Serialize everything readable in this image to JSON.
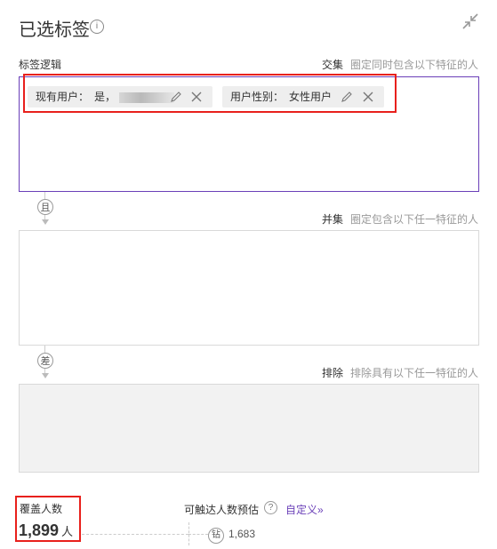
{
  "header": {
    "title": "已选标签",
    "info_icon": "i"
  },
  "logic": {
    "label": "标签逻辑"
  },
  "intersect": {
    "label": "交集",
    "description": "圈定同时包含以下特征的人",
    "tags": [
      {
        "name": "现有用户：",
        "value": "是，"
      },
      {
        "name": "用户性别：",
        "value": "女性用户"
      }
    ]
  },
  "op_and": "且",
  "union": {
    "label": "并集",
    "description": "圈定包含以下任一特征的人"
  },
  "op_diff": "差",
  "exclude": {
    "label": "排除",
    "description": "排除具有以下任一特征的人"
  },
  "coverage": {
    "label": "覆盖人数",
    "value": "1,899",
    "unit": "人"
  },
  "reach": {
    "label": "可触达人数预估",
    "help_icon": "?",
    "custom_link": "自定义»"
  },
  "diamond": {
    "symbol": "钻",
    "value": "1,683"
  },
  "colors": {
    "accent": "#6a3fb8",
    "highlight": "#e8201c"
  }
}
